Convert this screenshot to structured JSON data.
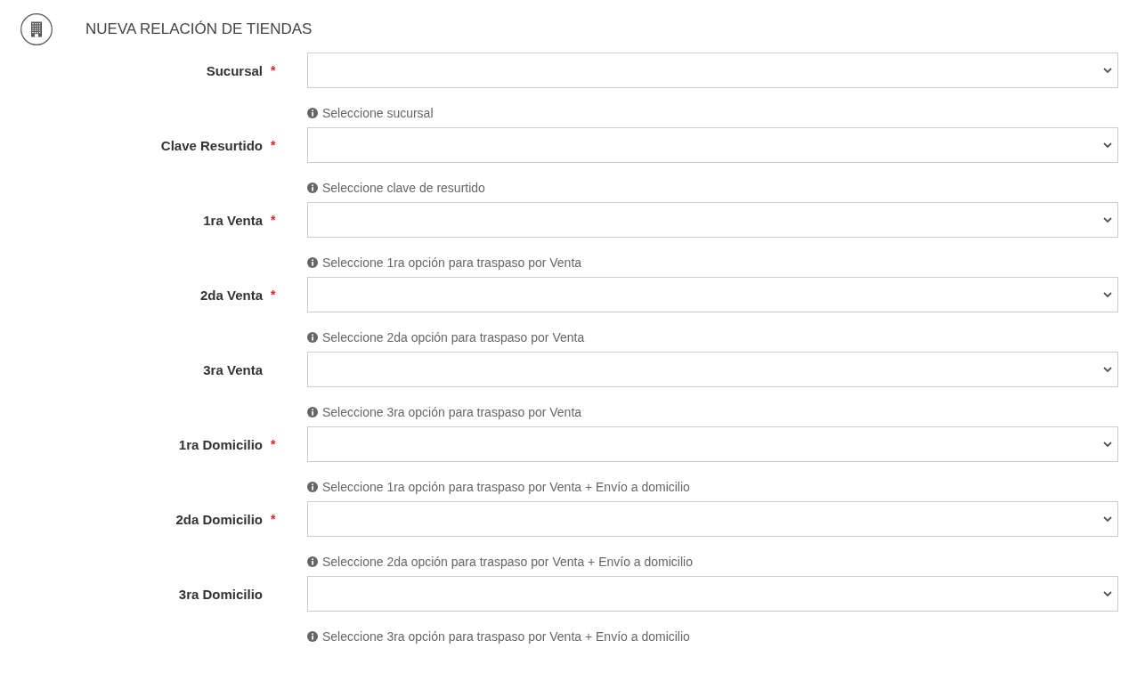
{
  "header": {
    "title": "NUEVA RELACIÓN DE TIENDAS"
  },
  "fields": [
    {
      "label": "Sucursal",
      "required_mark": "*",
      "help": "Seleccione sucursal"
    },
    {
      "label": "Clave Resurtido",
      "required_mark": "*",
      "help": "Seleccione clave de resurtido"
    },
    {
      "label": "1ra Venta",
      "required_mark": "*",
      "help": "Seleccione 1ra opción para traspaso por Venta"
    },
    {
      "label": "2da Venta",
      "required_mark": "*",
      "help": "Seleccione 2da opción para traspaso por Venta"
    },
    {
      "label": "3ra Venta",
      "help": "Seleccione 3ra opción para traspaso por Venta"
    },
    {
      "label": "1ra Domicilio",
      "required_mark": "*",
      "help": "Seleccione 1ra opción para traspaso por Venta + Envío a domicilio"
    },
    {
      "label": "2da Domicilio",
      "required_mark": "*",
      "help": "Seleccione 2da opción para traspaso por Venta + Envío a domicilio"
    },
    {
      "label": "3ra Domicilio",
      "help": "Seleccione 3ra opción para traspaso por Venta + Envío a domicilio"
    }
  ]
}
